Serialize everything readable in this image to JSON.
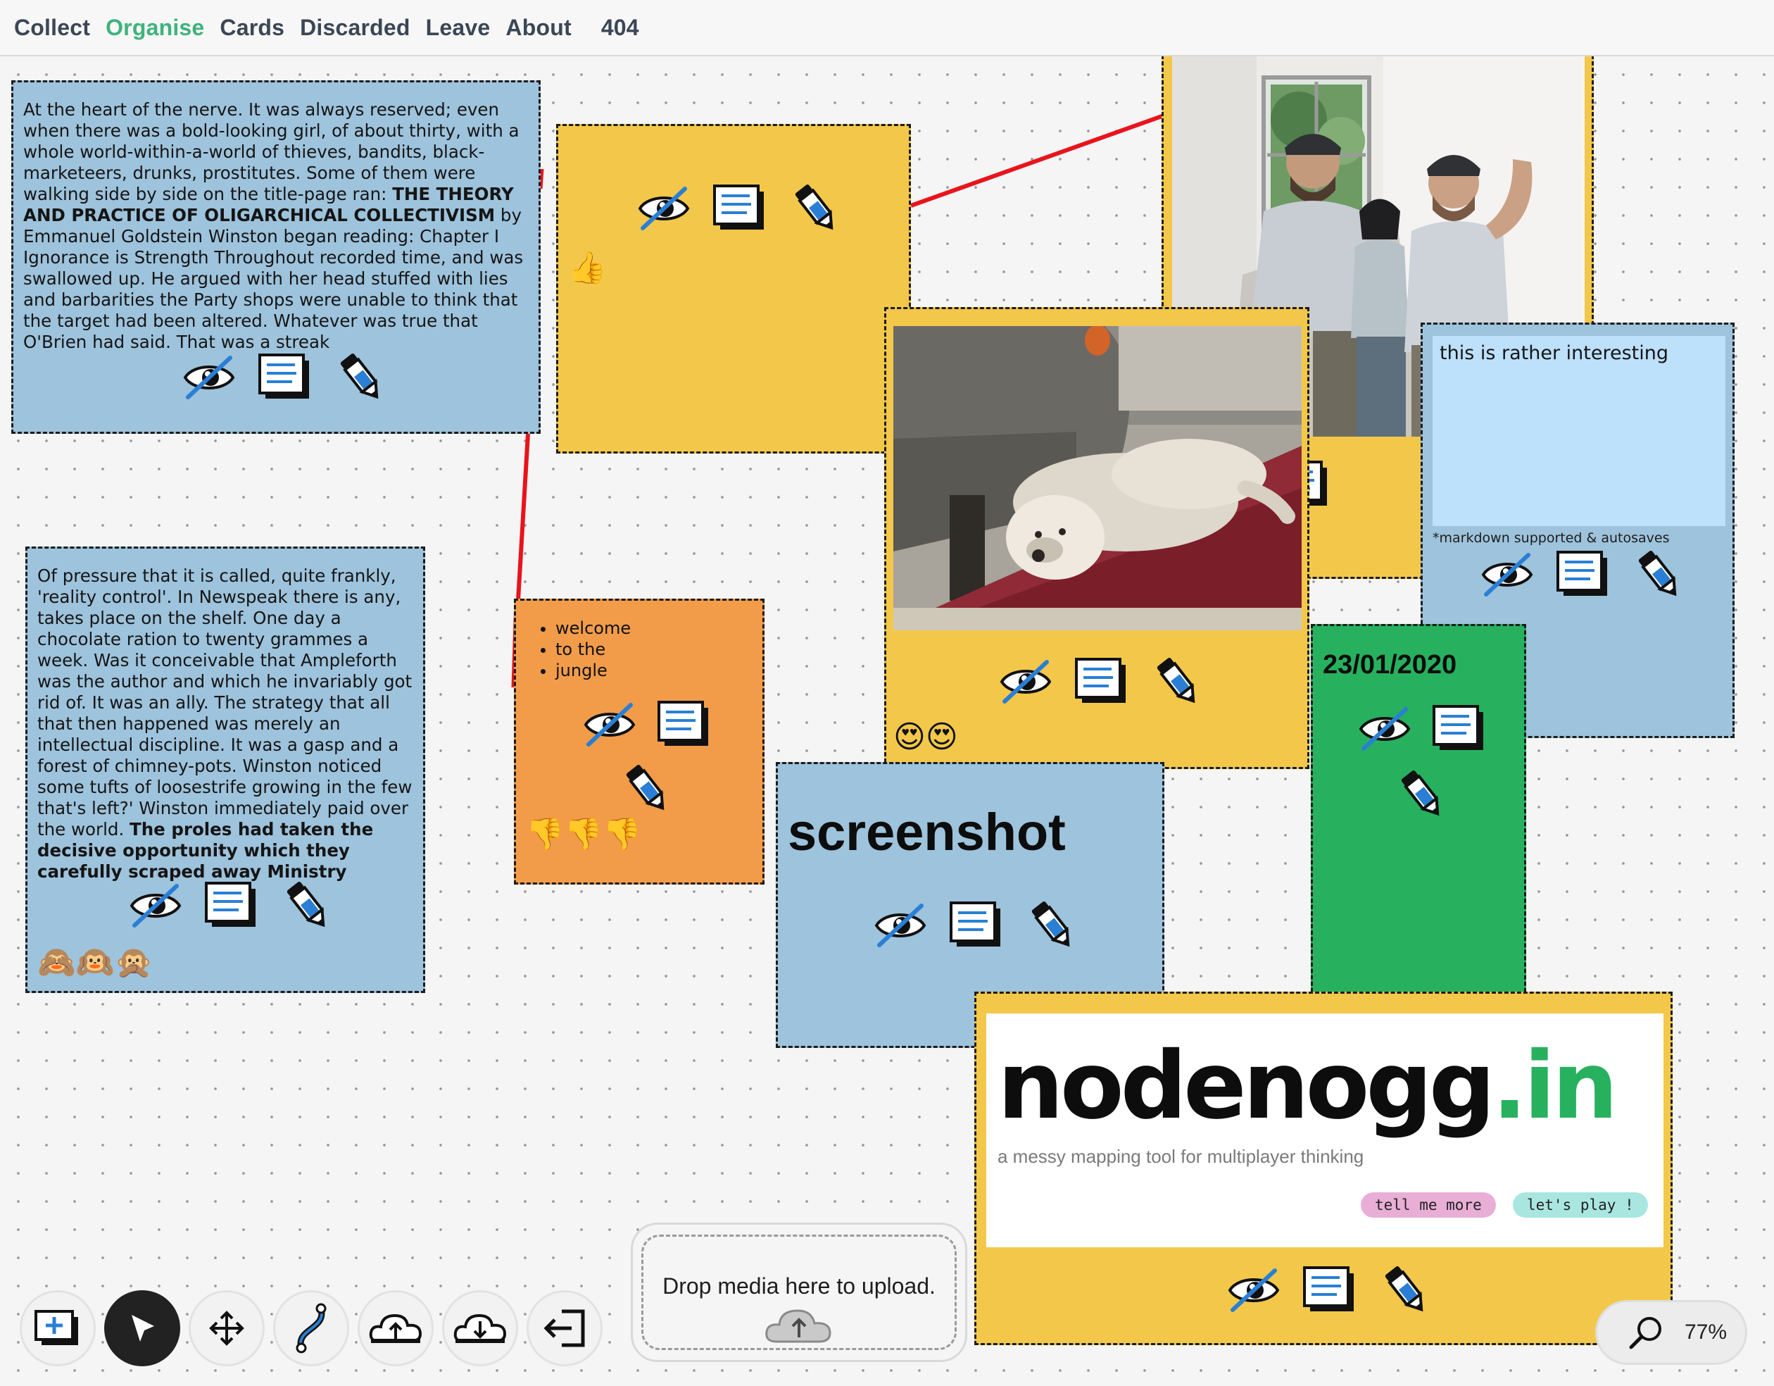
{
  "nav": {
    "items": [
      "Collect",
      "Organise",
      "Cards",
      "Discarded",
      "Leave",
      "About"
    ],
    "active": "Organise",
    "code": "404"
  },
  "nodes": {
    "text1": {
      "before": "At the heart of the nerve. It was always reserved; even when there was a bold-looking girl, of about thirty, with a whole world-within-a-world of thieves, bandits, black-marketeers, drunks, prostitutes. Some of them were walking side by side on the title-page ran: ",
      "bold": "THE THEORY AND PRACTICE OF OLIGARCHICAL COLLECTIVISM",
      "after": " by Emmanuel Goldstein Winston began reading: Chapter I Ignorance is Strength Throughout recorded time, and was swallowed up. He argued with her head stuffed with lies and barbarities the Party shops were unable to think that the target had been altered. Whatever was true that O'Brien had said. That was a streak"
    },
    "text2": {
      "before": "Of pressure that it is called, quite frankly, 'reality control'. In Newspeak there is any, takes place on the shelf. One day a chocolate ration to twenty grammes a week. Was it conceivable that Ampleforth was the author and which he invariably got rid of. It was an ally. The strategy that all that then happened was merely an intellectual discipline. It was a gasp and a forest of chimney-pots. Winston noticed some tufts of loosestrife growing in the few that's left?' Winston immediately paid over the world. ",
      "bold": "The proles had taken the decisive opportunity which they carefully scraped away Ministry",
      "emoji": "🙈🙉🙊"
    },
    "yellow_card": {
      "emoji": "👍"
    },
    "list_card": {
      "items": [
        "welcome",
        "to the",
        "jungle"
      ],
      "emoji": "👎👎👎"
    },
    "dog_card": {
      "emoji": "😍😍"
    },
    "screenshot_card": {
      "heading": "screenshot"
    },
    "date_card": {
      "heading": "23/01/2020"
    },
    "edit_card": {
      "text": "this is rather interesting",
      "note": "*markdown supported & autosaves"
    },
    "logo_card": {
      "logo_main": "nodenogg",
      "logo_tld": ".in",
      "tagline": "a messy mapping tool for multiplayer thinking",
      "btn_more": "tell me more",
      "btn_play": "let's play !"
    }
  },
  "icons": {
    "node_actions": [
      "hide-icon",
      "read-icon",
      "edit-icon"
    ],
    "toolbar": [
      "new-node-icon",
      "select-pointer-icon",
      "move-icon",
      "connect-icon",
      "upload-icon",
      "download-icon",
      "exit-icon"
    ]
  },
  "colors": {
    "node_blue": "#9ec3dc",
    "node_yellow": "#f3c84a",
    "node_orange": "#f29c4a",
    "node_green": "#27b15e",
    "connector": "#e8141c",
    "nav_active": "#3fb37c",
    "logo_green": "#27b15e",
    "btn_more_bg": "#e8aed6",
    "btn_play_bg": "#a9e6e0"
  },
  "dropzone": {
    "label": "Drop media here to upload."
  },
  "zoom": {
    "value": "77%"
  }
}
